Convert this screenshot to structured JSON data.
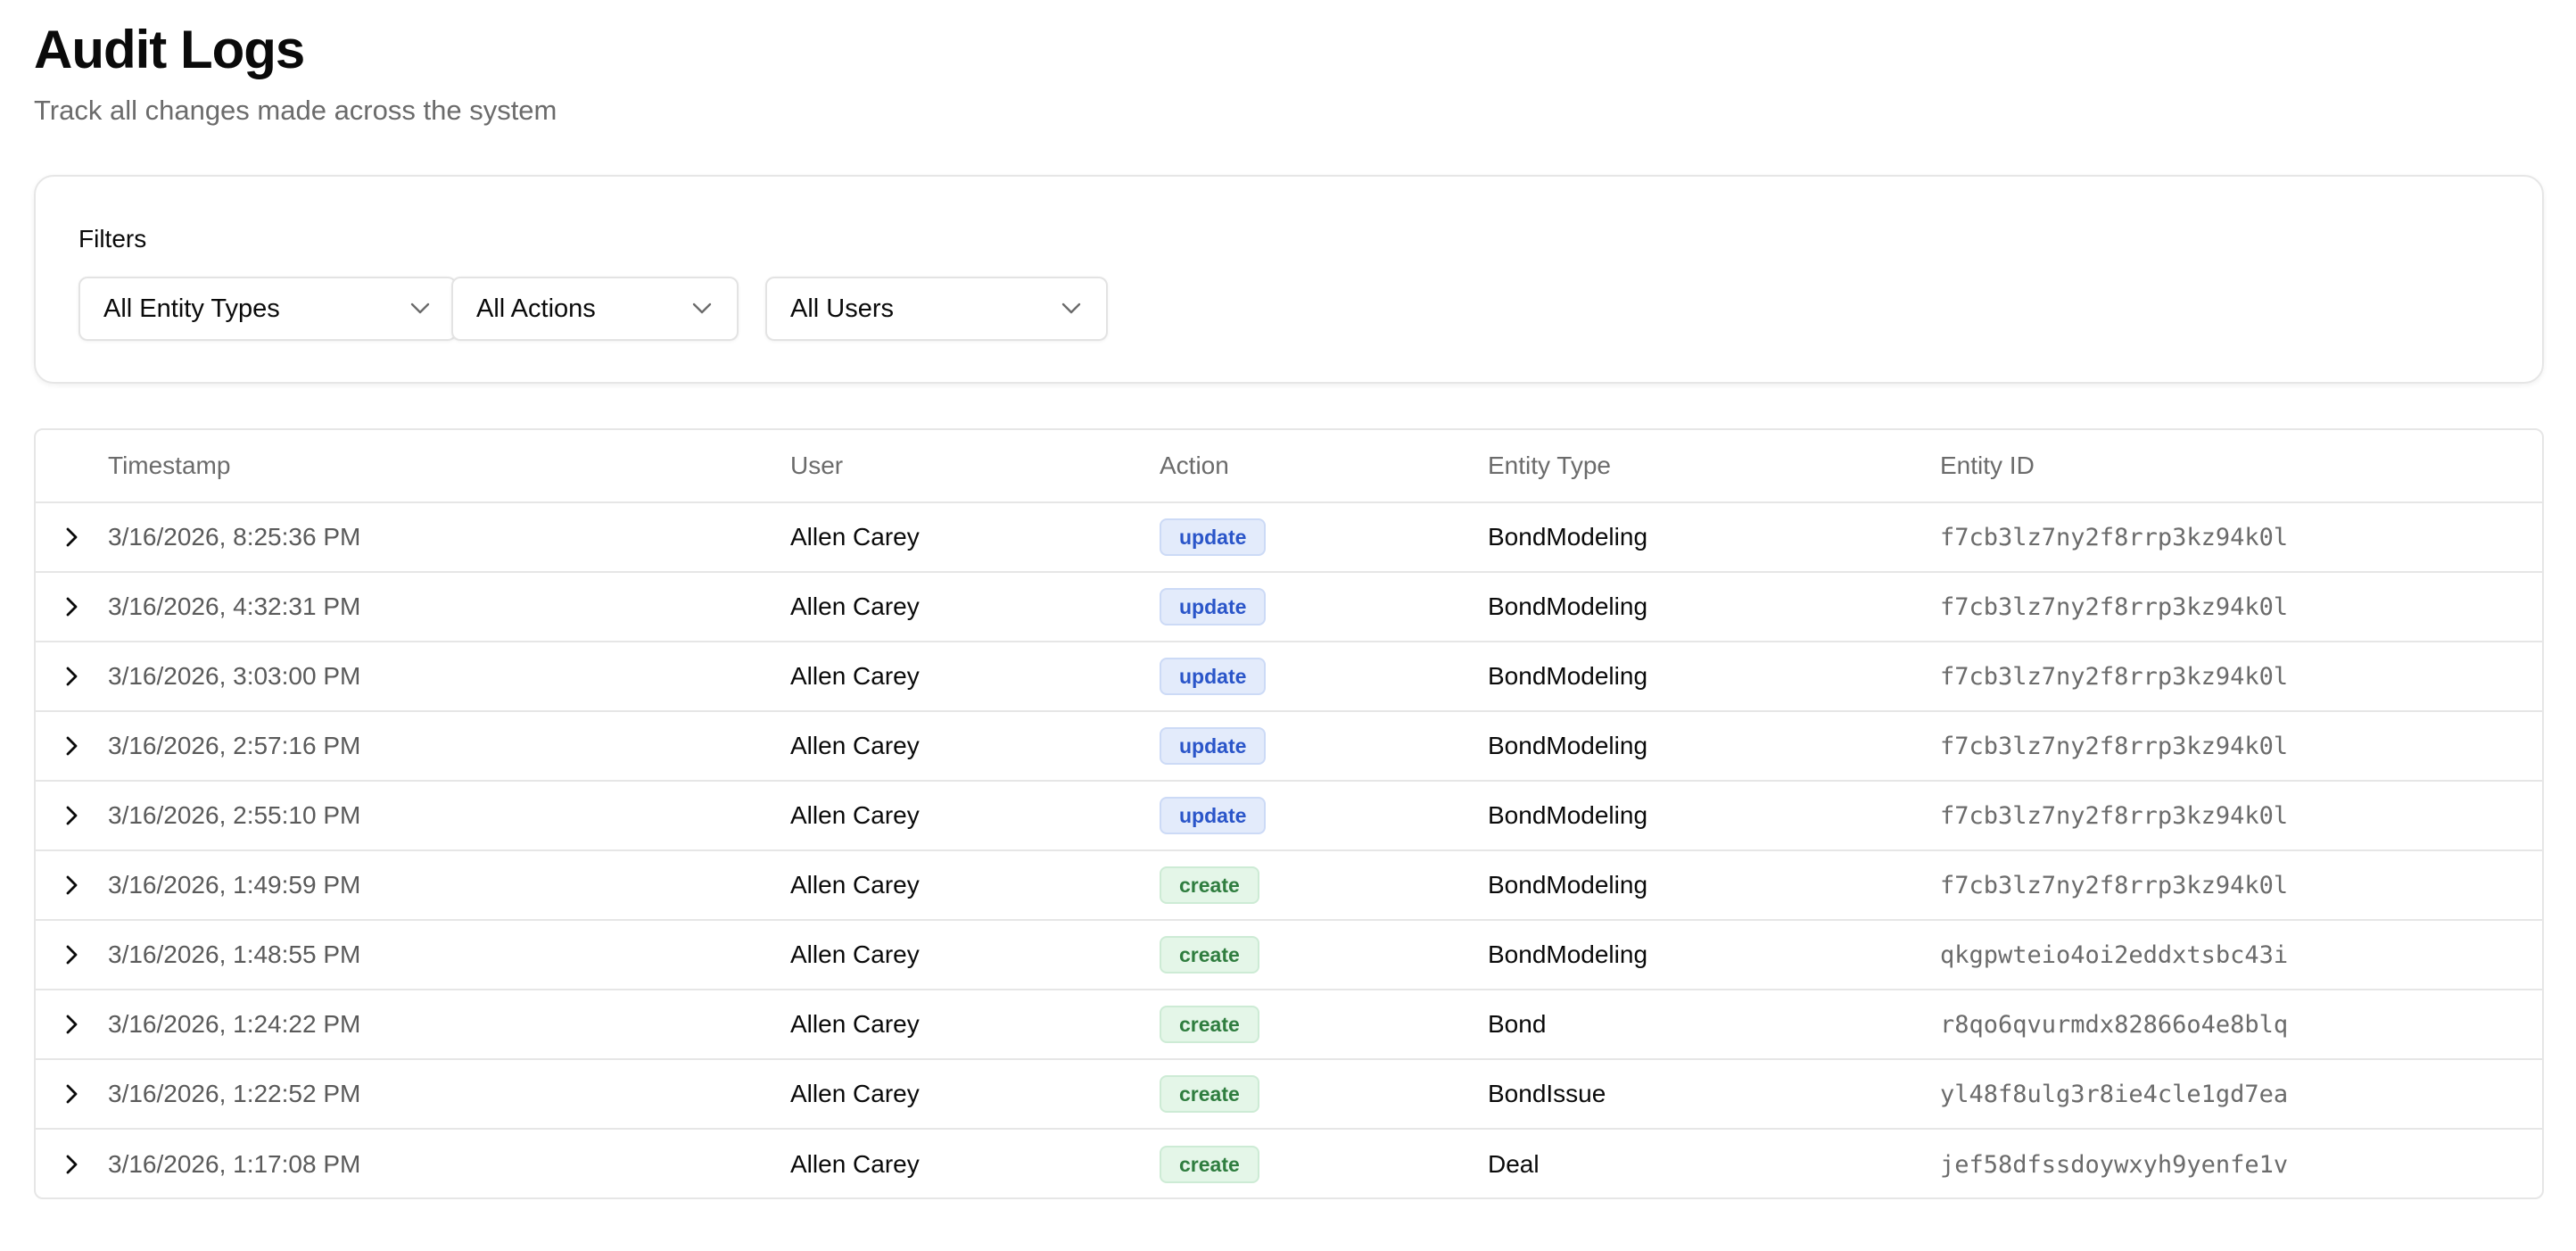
{
  "page": {
    "title": "Audit Logs",
    "subtitle": "Track all changes made across the system"
  },
  "filters": {
    "label": "Filters",
    "entity_type": {
      "selected": "All Entity Types"
    },
    "action": {
      "selected": "All Actions"
    },
    "user": {
      "selected": "All Users"
    }
  },
  "table": {
    "columns": {
      "timestamp": "Timestamp",
      "user": "User",
      "action": "Action",
      "entity_type": "Entity Type",
      "entity_id": "Entity ID"
    },
    "rows": [
      {
        "timestamp": "3/16/2026, 8:25:36 PM",
        "user": "Allen Carey",
        "action": "update",
        "entity_type": "BondModeling",
        "entity_id": "f7cb3lz7ny2f8rrp3kz94k0l"
      },
      {
        "timestamp": "3/16/2026, 4:32:31 PM",
        "user": "Allen Carey",
        "action": "update",
        "entity_type": "BondModeling",
        "entity_id": "f7cb3lz7ny2f8rrp3kz94k0l"
      },
      {
        "timestamp": "3/16/2026, 3:03:00 PM",
        "user": "Allen Carey",
        "action": "update",
        "entity_type": "BondModeling",
        "entity_id": "f7cb3lz7ny2f8rrp3kz94k0l"
      },
      {
        "timestamp": "3/16/2026, 2:57:16 PM",
        "user": "Allen Carey",
        "action": "update",
        "entity_type": "BondModeling",
        "entity_id": "f7cb3lz7ny2f8rrp3kz94k0l"
      },
      {
        "timestamp": "3/16/2026, 2:55:10 PM",
        "user": "Allen Carey",
        "action": "update",
        "entity_type": "BondModeling",
        "entity_id": "f7cb3lz7ny2f8rrp3kz94k0l"
      },
      {
        "timestamp": "3/16/2026, 1:49:59 PM",
        "user": "Allen Carey",
        "action": "create",
        "entity_type": "BondModeling",
        "entity_id": "f7cb3lz7ny2f8rrp3kz94k0l"
      },
      {
        "timestamp": "3/16/2026, 1:48:55 PM",
        "user": "Allen Carey",
        "action": "create",
        "entity_type": "BondModeling",
        "entity_id": "qkgpwteio4oi2eddxtsbc43i"
      },
      {
        "timestamp": "3/16/2026, 1:24:22 PM",
        "user": "Allen Carey",
        "action": "create",
        "entity_type": "Bond",
        "entity_id": "r8qo6qvurmdx82866o4e8blq"
      },
      {
        "timestamp": "3/16/2026, 1:22:52 PM",
        "user": "Allen Carey",
        "action": "create",
        "entity_type": "BondIssue",
        "entity_id": "yl48f8ulg3r8ie4cle1gd7ea"
      },
      {
        "timestamp": "3/16/2026, 1:17:08 PM",
        "user": "Allen Carey",
        "action": "create",
        "entity_type": "Deal",
        "entity_id": "jef58dfssdoywxyh9yenfe1v"
      }
    ]
  },
  "colors": {
    "update_badge_bg": "#e3ebfb",
    "update_badge_text": "#2a55c9",
    "create_badge_bg": "#e4f6e8",
    "create_badge_text": "#2f7d3f",
    "border": "#e6e6e6",
    "muted_text": "#6b6b6b"
  },
  "icons": {
    "select_chevron": "chevron-down-icon",
    "row_expand": "chevron-right-icon"
  }
}
